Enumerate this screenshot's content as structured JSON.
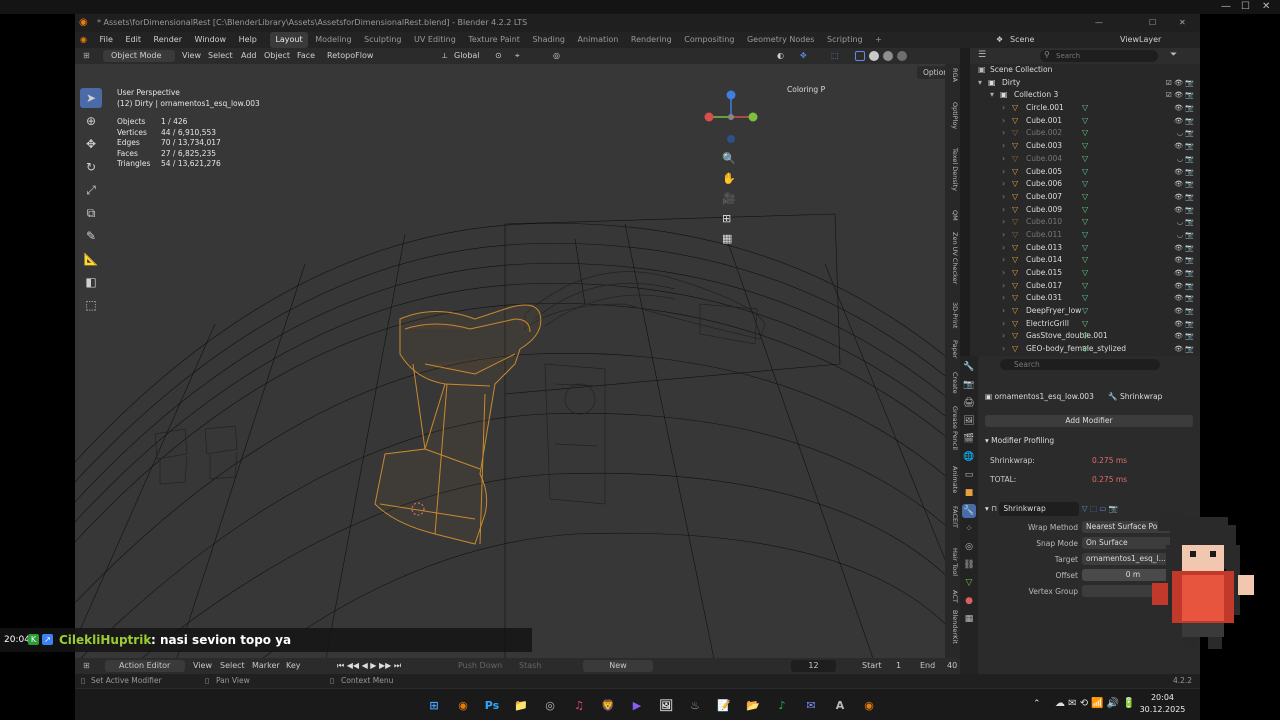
{
  "host": {
    "controls": [
      "—",
      "☐",
      "✕"
    ]
  },
  "window": {
    "title": "* Assets\\forDimensionalRest [C:\\BlenderLibrary\\Assets\\AssetsforDimensionalRest.blend] - Blender 4.2.2 LTS",
    "controls": [
      "—",
      "☐",
      "✕"
    ]
  },
  "menu": {
    "items": [
      "File",
      "Edit",
      "Render",
      "Window",
      "Help"
    ],
    "workspaces": [
      "Layout",
      "Modeling",
      "Sculpting",
      "UV Editing",
      "Texture Paint",
      "Shading",
      "Animation",
      "Rendering",
      "Compositing",
      "Geometry Nodes",
      "Scripting"
    ],
    "active_workspace": "Layout",
    "add_tab": "+",
    "scene_label": "Scene",
    "viewlayer_label": "ViewLayer"
  },
  "viewport_header": {
    "mode": "Object Mode",
    "menus": [
      "View",
      "Select",
      "Add",
      "Object",
      "Face"
    ],
    "addon": "RetopoFlow",
    "transform_orientation": "Global",
    "options": "Options",
    "coloring": "Coloring P"
  },
  "viewport_info": {
    "perspective": "User Perspective",
    "selection": "(12) Dirty | ornamentos1_esq_low.003",
    "stats": [
      {
        "label": "Objects",
        "value": "1 / 426"
      },
      {
        "label": "Vertices",
        "value": "44 / 6,910,553"
      },
      {
        "label": "Edges",
        "value": "70 / 13,734,017"
      },
      {
        "label": "Faces",
        "value": "27 / 6,825,235"
      },
      {
        "label": "Triangles",
        "value": "54 / 13,621,276"
      }
    ]
  },
  "gizmo": {
    "x_color": "#d94d4d",
    "y_color": "#7fbf3f",
    "z_color": "#3f7fdf"
  },
  "side_tabs": [
    "RGA",
    "OptiPloy",
    "Texel Density",
    "QM",
    "Zen UV Checker",
    "3D-Print",
    "Paper",
    "Create",
    "Grease Pencil",
    "Animate",
    "FACEIT",
    "Hair Tool",
    "ACT",
    "BlenderKit"
  ],
  "outliner": {
    "search_placeholder": "Search",
    "root": "Scene Collection",
    "collection_dirty": "Dirty",
    "collection_3": "Collection 3",
    "objects": [
      {
        "name": "Circle.001",
        "dim": false
      },
      {
        "name": "Cube.001",
        "dim": false
      },
      {
        "name": "Cube.002",
        "dim": true
      },
      {
        "name": "Cube.003",
        "dim": false
      },
      {
        "name": "Cube.004",
        "dim": true
      },
      {
        "name": "Cube.005",
        "dim": false
      },
      {
        "name": "Cube.006",
        "dim": false
      },
      {
        "name": "Cube.007",
        "dim": false
      },
      {
        "name": "Cube.009",
        "dim": false
      },
      {
        "name": "Cube.010",
        "dim": true
      },
      {
        "name": "Cube.011",
        "dim": true
      },
      {
        "name": "Cube.013",
        "dim": false
      },
      {
        "name": "Cube.014",
        "dim": false
      },
      {
        "name": "Cube.015",
        "dim": false
      },
      {
        "name": "Cube.017",
        "dim": false
      },
      {
        "name": "Cube.031",
        "dim": false
      },
      {
        "name": "DeepFryer_low",
        "dim": false
      },
      {
        "name": "ElectricGrill",
        "dim": false
      },
      {
        "name": "GasStove_double.001",
        "dim": false
      },
      {
        "name": "GEO-body_female_stylized",
        "dim": false
      }
    ]
  },
  "properties": {
    "search_placeholder": "Search",
    "object_name": "ornamentos1_esq_low.003",
    "modifier_name": "Shrinkwrap",
    "add_modifier": "Add Modifier",
    "profiling_title": "Modifier Profiling",
    "profiling_rows": [
      {
        "label": "Shrinkwrap:",
        "value": "0.275 ms"
      },
      {
        "label": "TOTAL:",
        "value": "0.275 ms"
      }
    ],
    "modifier_fields": [
      {
        "label": "Wrap Method",
        "value": "Nearest Surface Point"
      },
      {
        "label": "Snap Mode",
        "value": "On Surface"
      },
      {
        "label": "Target",
        "value": "ornamentos1_esq_l..."
      },
      {
        "label": "Offset",
        "value": "0 m"
      },
      {
        "label": "Vertex Group",
        "value": ""
      }
    ]
  },
  "timeline": {
    "editor": "Action Editor",
    "menus": [
      "View",
      "Select",
      "Marker",
      "Key"
    ],
    "push_down": "Push Down",
    "stash": "Stash",
    "new": "New",
    "frame": "12",
    "start_label": "Start",
    "start_value": "1",
    "end_label": "End",
    "end_value": "40"
  },
  "statusbar": {
    "left": "Set Active Modifier",
    "mid": "Pan View",
    "right": "Context Menu",
    "version": "4.2.2"
  },
  "taskbar": {
    "time": "20:04",
    "date": "30.12.2025",
    "apps": [
      "start",
      "blender",
      "photoshop",
      "files",
      "browser",
      "music",
      "brave",
      "video",
      "images",
      "steam",
      "notes",
      "explorer",
      "spotify",
      "messenger",
      "ark",
      "blender"
    ]
  },
  "chat": {
    "time": "20:04",
    "user": "CilekliHuptrik",
    "message": ": nasi sevion topo ya",
    "user_color": "#9acd32"
  }
}
